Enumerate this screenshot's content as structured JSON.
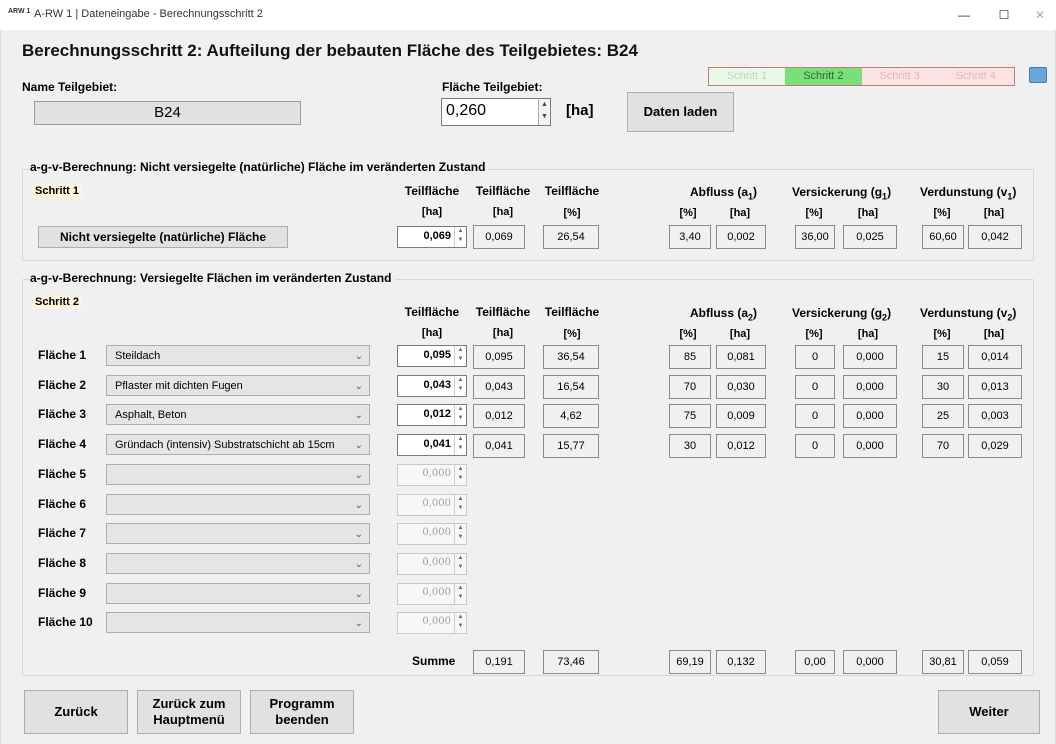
{
  "window": {
    "icon_text": "ARW 1",
    "title": "A-RW 1 | Dateneingabe - Berechnungsschritt 2",
    "minimize": "—",
    "maximize": "☐",
    "close": "✕"
  },
  "heading": "Berechnungsschritt 2: Aufteilung der bebauten Fläche des Teilgebietes: B24",
  "name_label": "Name Teilgebiet:",
  "name_value": "B24",
  "area_label": "Fläche Teilgebiet:",
  "area_value": "0,260",
  "area_unit": "[ha]",
  "load_button": "Daten laden",
  "steps": [
    {
      "label": "Schritt 1",
      "bg": "#e8f9e8",
      "fg": "#b9d9b9"
    },
    {
      "label": "Schritt 2",
      "bg": "#79e079",
      "fg": "#2a6b2a"
    },
    {
      "label": "Schritt 3",
      "bg": "#fbe3e3",
      "fg": "#e8b4b4"
    },
    {
      "label": "Schritt 4",
      "bg": "#fbe3e3",
      "fg": "#e8b4b4"
    }
  ],
  "section1": {
    "title": "a-g-v-Berechnung: Nicht versiegelte (natürliche) Fläche im veränderten  Zustand",
    "step": "Schritt 1",
    "button": "Nicht versiegelte (natürliche) Fläche",
    "input": "0,069",
    "values": [
      "0,069",
      "26,54",
      "3,40",
      "0,002",
      "36,00",
      "0,025",
      "60,60",
      "0,042"
    ]
  },
  "section2": {
    "title": "a-g-v-Berechnung: Versiegelte Flächen im veränderten  Zustand",
    "step": "Schritt 2"
  },
  "headers": {
    "teilflaeche": "Teilfläche",
    "ha": "[ha]",
    "pct": "[%]",
    "abfluss1": "Abfluss (a",
    "versick1": "Versickerung (g",
    "verd1": "Verdunstung (v",
    "sub1": "1",
    "sub2": "2",
    "close": ")"
  },
  "rows": [
    {
      "label": "Fläche 1",
      "select": "Steildach",
      "input": "0,095",
      "values": [
        "0,095",
        "36,54",
        "85",
        "0,081",
        "0",
        "0,000",
        "15",
        "0,014"
      ]
    },
    {
      "label": "Fläche 2",
      "select": "Pflaster mit dichten Fugen",
      "input": "0,043",
      "values": [
        "0,043",
        "16,54",
        "70",
        "0,030",
        "0",
        "0,000",
        "30",
        "0,013"
      ]
    },
    {
      "label": "Fläche 3",
      "select": "Asphalt, Beton",
      "input": "0,012",
      "values": [
        "0,012",
        "4,62",
        "75",
        "0,009",
        "0",
        "0,000",
        "25",
        "0,003"
      ]
    },
    {
      "label": "Fläche 4",
      "select": "Gründach (intensiv) Substratschicht ab 15cm",
      "input": "0,041",
      "values": [
        "0,041",
        "15,77",
        "30",
        "0,012",
        "0",
        "0,000",
        "70",
        "0,029"
      ]
    },
    {
      "label": "Fläche 5",
      "select": "",
      "input": "0,000"
    },
    {
      "label": "Fläche 6",
      "select": "",
      "input": "0,000"
    },
    {
      "label": "Fläche 7",
      "select": "",
      "input": "0,000"
    },
    {
      "label": "Fläche 8",
      "select": "",
      "input": "0,000"
    },
    {
      "label": "Fläche 9",
      "select": "",
      "input": "0,000"
    },
    {
      "label": "Fläche 10",
      "select": "",
      "input": "0,000"
    }
  ],
  "summe": {
    "label": "Summe",
    "values": [
      "0,191",
      "73,46",
      "69,19",
      "0,132",
      "0,00",
      "0,000",
      "30,81",
      "0,059"
    ]
  },
  "footer": {
    "back": "Zurück",
    "main_menu": "Zurück zum Hauptmenü",
    "exit": "Programm beenden",
    "next": "Weiter"
  }
}
